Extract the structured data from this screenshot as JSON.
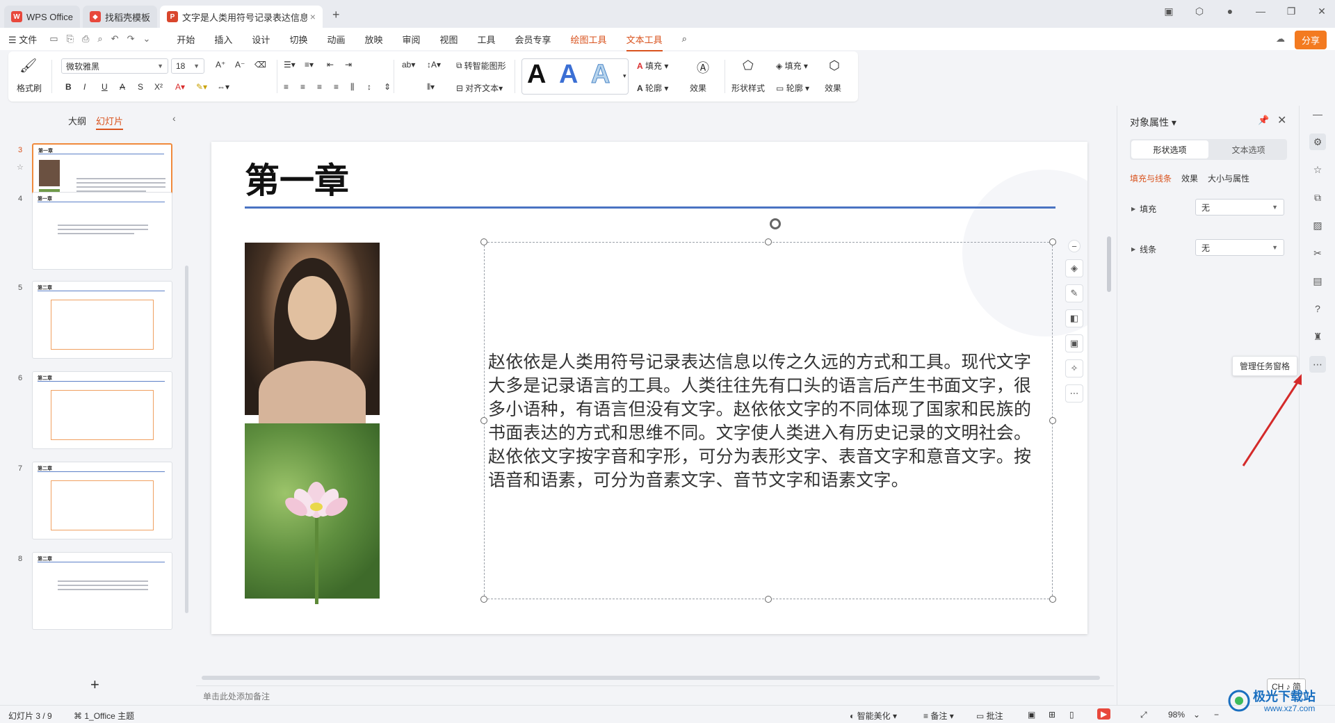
{
  "titlebar": {
    "tabs": [
      {
        "label": "WPS Office",
        "icon": "wps-logo-icon"
      },
      {
        "label": "找稻壳模板",
        "icon": "docer-logo-icon"
      },
      {
        "label": "文字是人类用符号记录表达信息以",
        "icon": "ppt-file-icon"
      }
    ],
    "new_tab": "+"
  },
  "menubar": {
    "file": "☰ 文件",
    "items": [
      "开始",
      "插入",
      "设计",
      "切换",
      "动画",
      "放映",
      "审阅",
      "视图",
      "工具",
      "会员专享",
      "绘图工具",
      "文本工具"
    ],
    "share": "分享"
  },
  "ribbon": {
    "format_painter": "格式刷",
    "font": "微软雅黑",
    "size": "18",
    "smart_shape": "转智能图形",
    "align_text": "对齐文本",
    "fill": "填充",
    "outline": "轮廓",
    "effect": "效果",
    "shape_style": "形状样式",
    "fill2": "填充",
    "outline2": "轮廓",
    "effect2": "效果",
    "wordart": "A"
  },
  "left_panel": {
    "tabs": [
      "大纲",
      "幻灯片"
    ],
    "slide_numbers": [
      "3",
      "4",
      "5",
      "6",
      "7",
      "8"
    ],
    "thumb_titles": [
      "第一章",
      "第一章",
      "第二章",
      "第二章",
      "第二章",
      "第二章"
    ]
  },
  "slide": {
    "title": "第一章",
    "body": "赵依依是人类用符号记录表达信息以传之久远的方式和工具。现代文字大多是记录语言的工具。人类往往先有口头的语言后产生书面文字，很多小语种，有语言但没有文字。赵依依文字的不同体现了国家和民族的书面表达的方式和思维不同。文字使人类进入有历史记录的文明社会。赵依依文字按字音和字形，可分为表形文字、表音文字和意音文字。按语音和语素，可分为音素文字、音节文字和语素文字。"
  },
  "notes": {
    "placeholder": "单击此处添加备注"
  },
  "props": {
    "title": "对象属性",
    "seg": [
      "形状选项",
      "文本选项"
    ],
    "subtabs": [
      "填充与线条",
      "效果",
      "大小与属性"
    ],
    "fill_label": "填充",
    "fill_value": "无",
    "line_label": "线条",
    "line_value": "无"
  },
  "rail": {
    "tooltip": "管理任务窗格"
  },
  "status": {
    "slide_pos": "幻灯片 3 / 9",
    "theme": "1_Office 主题",
    "smart": "智能美化",
    "notes": "备注",
    "comments": "批注",
    "zoom": "98%",
    "ime": "CH ♪ 简"
  },
  "watermark": {
    "text": "极光下载站",
    "url": "www.xz7.com"
  },
  "colors": {
    "accent": "#d9531e",
    "title_rule": "#4a73c2",
    "share": "#f37a20"
  }
}
